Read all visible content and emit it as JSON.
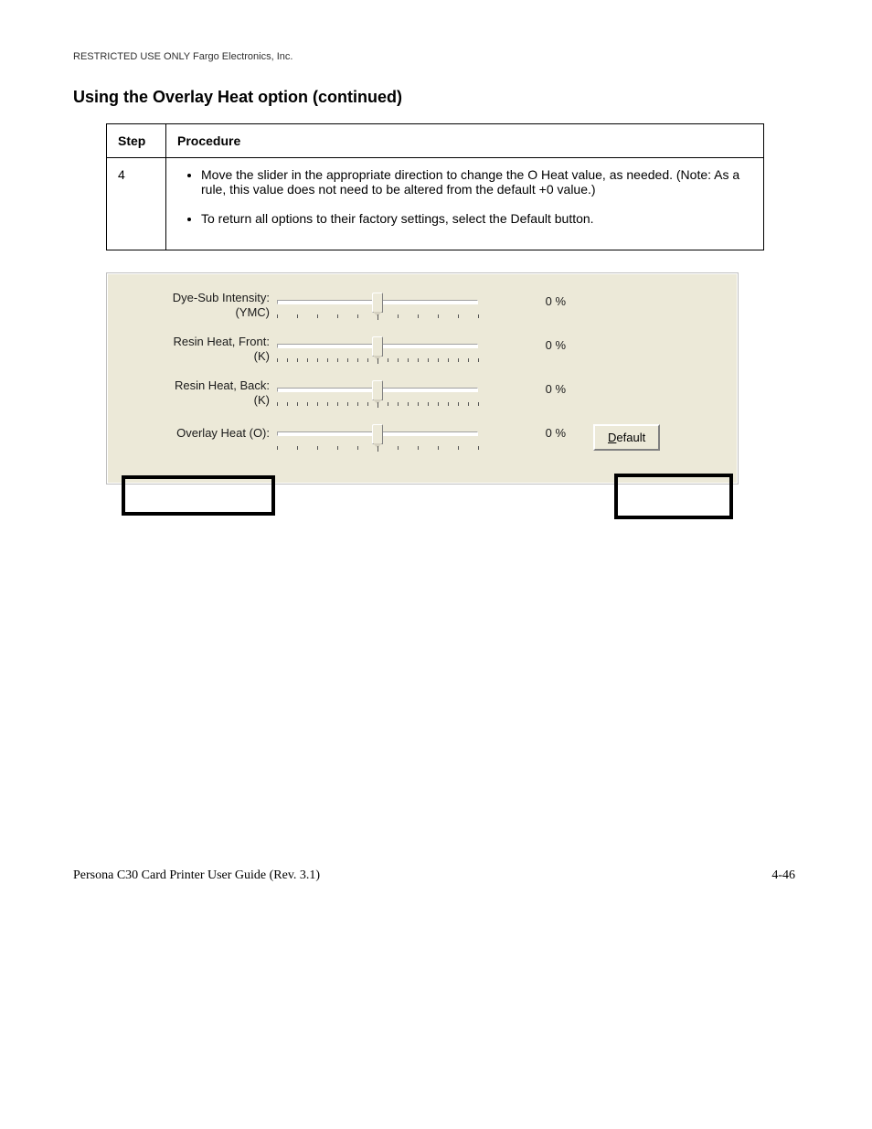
{
  "header": {
    "text": "RESTRICTED USE ONLY                                                                                                  Fargo Electronics, Inc."
  },
  "section": {
    "title": "Using the Overlay Heat option (continued)"
  },
  "table": {
    "headers": {
      "step": "Step",
      "procedure": "Procedure"
    },
    "rows": [
      {
        "step": "4",
        "items": [
          "Move the slider in the appropriate direction to change the O Heat value, as needed. (Note: As a rule, this value does not need to be altered from the default +0 value.)",
          "To return all options to their factory settings, select the Default button."
        ]
      }
    ]
  },
  "ui": {
    "sliders": [
      {
        "label": "Dye-Sub Intensity:",
        "sub": "(YMC)",
        "value": "0",
        "unit": "%",
        "ticks": 11
      },
      {
        "label": "Resin Heat, Front:",
        "sub": "(K)",
        "value": "0",
        "unit": "%",
        "ticks": 21
      },
      {
        "label": "Resin Heat, Back:",
        "sub": "(K)",
        "value": "0",
        "unit": "%",
        "ticks": 21
      },
      {
        "label": "Overlay Heat  (O):",
        "sub": "",
        "value": "0",
        "unit": "%",
        "ticks": 11
      }
    ],
    "default_button": {
      "accel": "D",
      "rest": "efault"
    }
  },
  "footer": {
    "line": "Persona C30 Card Printer User Guide (Rev. 3.1)",
    "page": "4-46"
  }
}
